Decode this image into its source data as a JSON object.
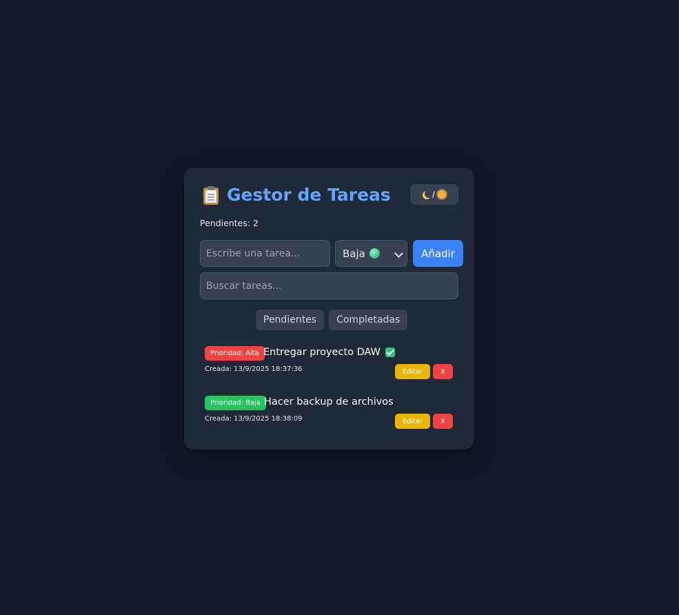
{
  "header": {
    "title": "Gestor de Tareas",
    "title_icon": "clipboard-icon",
    "theme_toggle_separator": "/",
    "theme_toggle_icons": [
      "moon-icon",
      "sun-icon"
    ]
  },
  "counter": {
    "label": "Pendientes: 2"
  },
  "new_task": {
    "placeholder": "Escribe una tarea...",
    "priority_selected": "Baja",
    "priority_icon": "green-circle-icon",
    "add_label": "Añadir"
  },
  "search": {
    "placeholder": "Buscar tareas..."
  },
  "filters": [
    "Pendientes",
    "Completadas"
  ],
  "tasks": [
    {
      "priority_label": "Prioridad: Alta",
      "priority_color": "#ef4444",
      "text": "Entregar proyecto DAW",
      "completed_icon": "check-mark-icon",
      "created": "Creada: 13/9/2025 18:37:36",
      "edit_label": "Editar",
      "delete_label": "X"
    },
    {
      "priority_label": "Prioridad: Baja",
      "priority_color": "#22c55e",
      "text": "Hacer backup de archivos",
      "created": "Creada: 13/9/2025 18:38:09",
      "edit_label": "Editar",
      "delete_label": "X"
    }
  ],
  "colors": {
    "background": "#111827",
    "card": "#1f2937",
    "accent": "#3b82f6",
    "title": "#60a5fa",
    "edit": "#eab308",
    "delete": "#ef4444"
  }
}
